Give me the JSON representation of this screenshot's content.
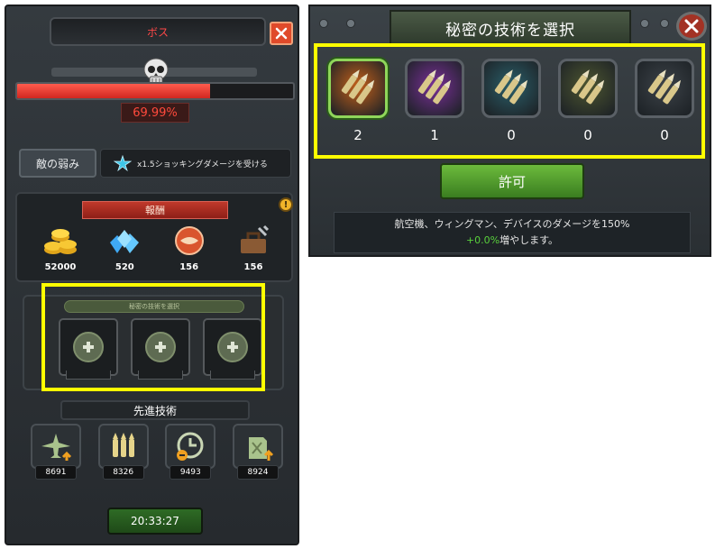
{
  "left": {
    "boss_title": "ボス",
    "hp_percent_text": "69.99%",
    "hp_fraction": 0.6999,
    "weakness_label": "敵の弱み",
    "weakness_desc": "x1.5ショッキングダメージを受ける",
    "reward_header": "報酬",
    "info_badge": "!",
    "rewards": [
      {
        "icon": "gold-coins-icon",
        "value": "52000"
      },
      {
        "icon": "blue-gems-icon",
        "value": "520"
      },
      {
        "icon": "handshake-medal-icon",
        "value": "156"
      },
      {
        "icon": "toolbox-icon",
        "value": "156"
      }
    ],
    "secret_title": "秘密の技術を選択",
    "advanced_label": "先進技術",
    "advanced": [
      {
        "icon": "plane-upgrade-icon",
        "value": "8691"
      },
      {
        "icon": "bullets-icon",
        "value": "8326"
      },
      {
        "icon": "clock-minus-icon",
        "value": "9493"
      },
      {
        "icon": "fuel-can-icon",
        "value": "8924"
      }
    ],
    "timer": "20:33:27"
  },
  "right": {
    "title": "秘密の技術を選択",
    "techs": [
      {
        "icon": "orange-bullets-icon",
        "count": "2",
        "color": "#c4601a",
        "selected": true
      },
      {
        "icon": "purple-bullets-icon",
        "count": "1",
        "color": "#7a2f98"
      },
      {
        "icon": "teal-bullets-icon",
        "count": "0",
        "color": "#2a5f6a"
      },
      {
        "icon": "olive-bullets-icon",
        "count": "0",
        "color": "#4d5630"
      },
      {
        "icon": "gray-bullets-icon",
        "count": "0",
        "color": "#3c4248"
      }
    ],
    "allow_label": "許可",
    "desc_line1": "航空機、ウィングマン、デバイスのダメージを150%",
    "desc_green": "+0.0%",
    "desc_line2_rest": "増やします。"
  },
  "colors": {
    "highlight": "#ffff00",
    "hp_red": "#e0342a",
    "accent_green": "#59d13c"
  }
}
